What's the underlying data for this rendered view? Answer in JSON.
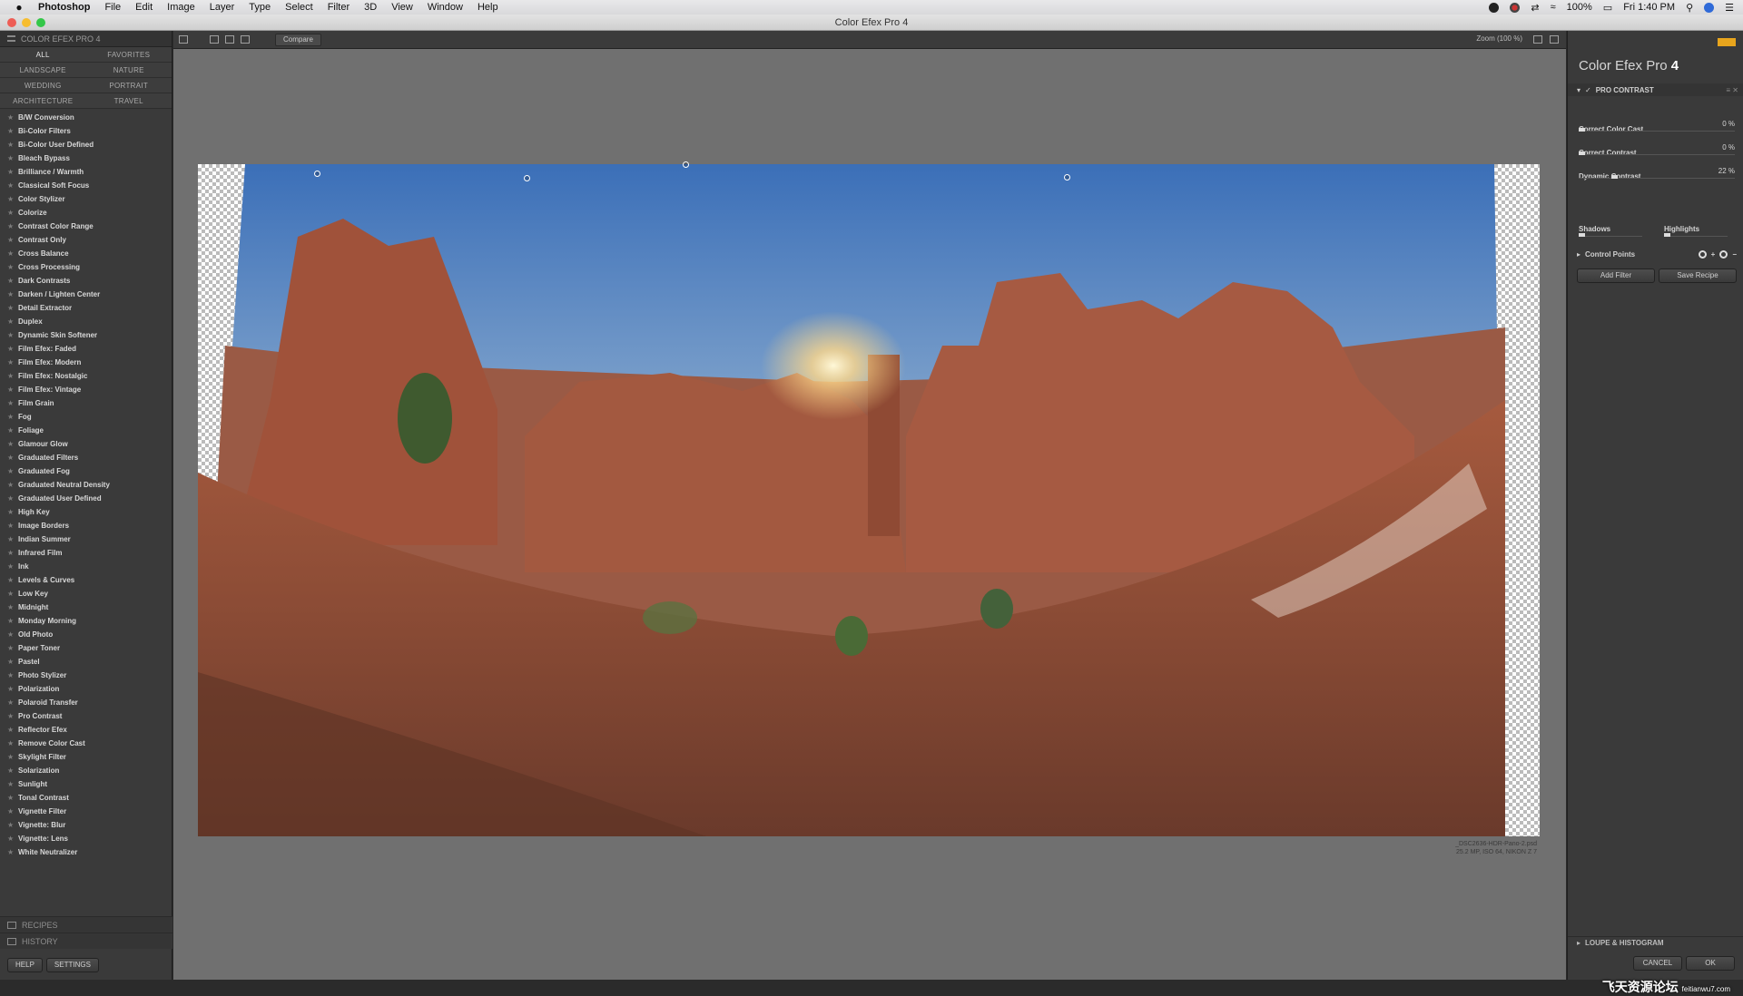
{
  "menubar": {
    "app_name": "Photoshop",
    "menus": [
      "File",
      "Edit",
      "Image",
      "Layer",
      "Type",
      "Select",
      "Filter",
      "3D",
      "View",
      "Window",
      "Help"
    ],
    "battery": "100%",
    "clock": "Fri 1:40 PM"
  },
  "window": {
    "title": "Color Efex Pro 4"
  },
  "left_panel": {
    "header": "COLOR EFEX PRO 4",
    "categories": [
      "ALL",
      "FAVORITES",
      "LANDSCAPE",
      "NATURE",
      "WEDDING",
      "PORTRAIT",
      "ARCHITECTURE",
      "TRAVEL"
    ],
    "filters": [
      "B/W Conversion",
      "Bi-Color Filters",
      "Bi-Color User Defined",
      "Bleach Bypass",
      "Brilliance / Warmth",
      "Classical Soft Focus",
      "Color Stylizer",
      "Colorize",
      "Contrast Color Range",
      "Contrast Only",
      "Cross Balance",
      "Cross Processing",
      "Dark Contrasts",
      "Darken / Lighten Center",
      "Detail Extractor",
      "Duplex",
      "Dynamic Skin Softener",
      "Film Efex: Faded",
      "Film Efex: Modern",
      "Film Efex: Nostalgic",
      "Film Efex: Vintage",
      "Film Grain",
      "Fog",
      "Foliage",
      "Glamour Glow",
      "Graduated Filters",
      "Graduated Fog",
      "Graduated Neutral Density",
      "Graduated User Defined",
      "High Key",
      "Image Borders",
      "Indian Summer",
      "Infrared Film",
      "Ink",
      "Levels & Curves",
      "Low Key",
      "Midnight",
      "Monday Morning",
      "Old Photo",
      "Paper Toner",
      "Pastel",
      "Photo Stylizer",
      "Polarization",
      "Polaroid Transfer",
      "Pro Contrast",
      "Reflector Efex",
      "Remove Color Cast",
      "Skylight Filter",
      "Solarization",
      "Sunlight",
      "Tonal Contrast",
      "Vignette Filter",
      "Vignette: Blur",
      "Vignette: Lens",
      "White Neutralizer"
    ],
    "recipes_label": "RECIPES",
    "history_label": "HISTORY",
    "help_label": "HELP",
    "settings_label": "SETTINGS"
  },
  "toolbar": {
    "compare_label": "Compare",
    "zoom_label": "Zoom (100 %)"
  },
  "file_info": {
    "name": "_DSC2636-HDR-Pano-2.psd",
    "meta": "25.2 MP, ISO 64, NIKON Z 7"
  },
  "right_panel": {
    "product_name": "Color Efex Pro",
    "product_version": "4",
    "active_filter": "PRO CONTRAST",
    "sliders": [
      {
        "label": "Correct Color Cast",
        "value": "0 %",
        "level": 0
      },
      {
        "label": "Correct Contrast",
        "value": "0 %",
        "level": 0
      },
      {
        "label": "Dynamic Contrast",
        "value": "22 %",
        "level": 0.22
      }
    ],
    "shadows_label": "Shadows",
    "highlights_label": "Highlights",
    "control_points_label": "Control Points",
    "add_filter_label": "Add Filter",
    "save_recipe_label": "Save Recipe",
    "loupe_label": "LOUPE & HISTOGRAM",
    "cancel_label": "CANCEL",
    "ok_label": "OK"
  },
  "watermark": {
    "text": "飞天资源论坛",
    "url": "feitianwu7.com"
  }
}
